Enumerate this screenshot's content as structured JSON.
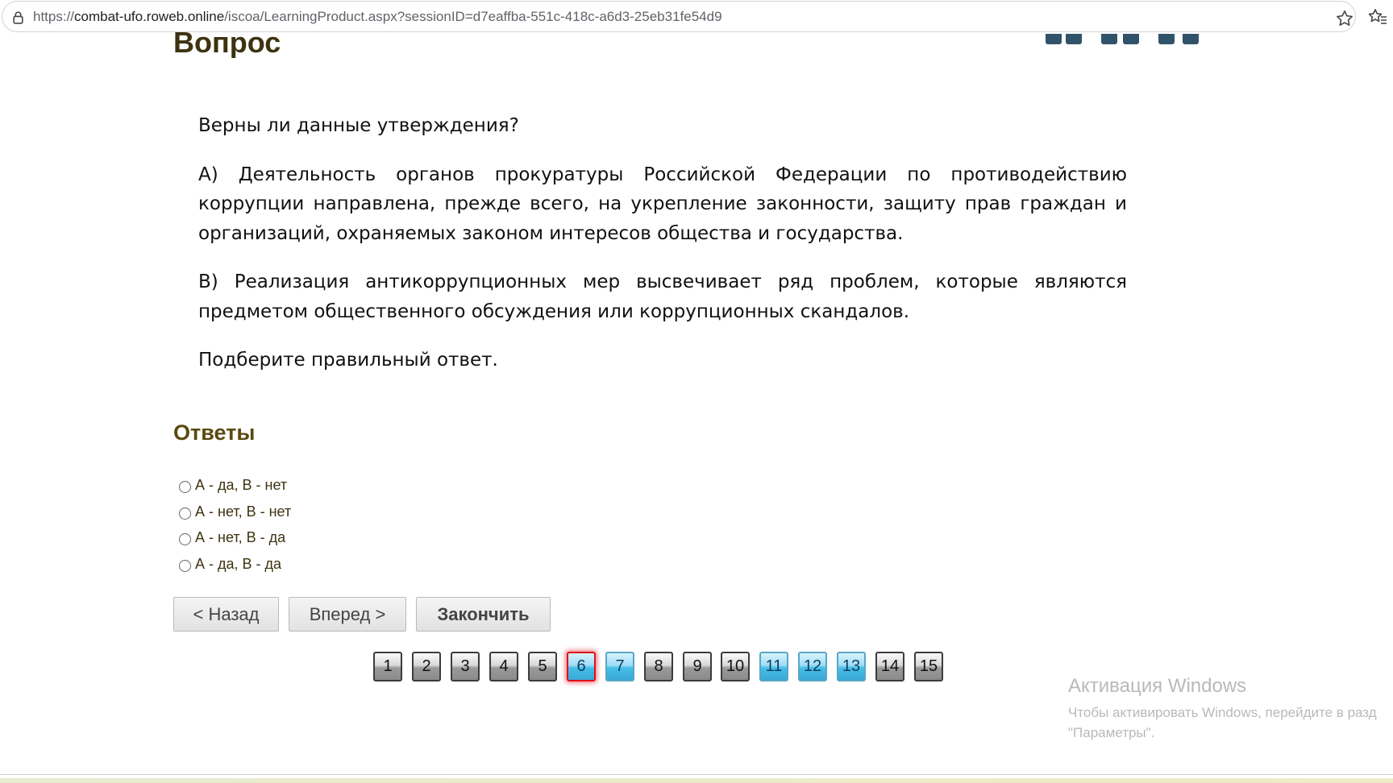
{
  "browser": {
    "url_prefix": "https://",
    "url_domain": "combat-ufo.roweb.online",
    "url_path": "/iscoa/LearningProduct.aspx?sessionID=d7eaffba-551c-418c-a6d3-25eb31fe54d9",
    "icons": [
      "lock-icon",
      "star-icon",
      "favorites-icon"
    ]
  },
  "page": {
    "question_heading": "Вопрос",
    "question": {
      "intro": "Верны ли данные утверждения?",
      "statement_a": "А) Деятельность органов прокуратуры Российской Федерации по противодействию коррупции направлена, прежде всего, на укрепление законности, защиту прав граждан и организаций, охраняемых законом интересов общества и государства.",
      "statement_b": "В) Реализация антикоррупционных мер высвечивает ряд проблем, которые являются предметом общественного обсуждения или коррупционных скандалов.",
      "prompt": "Подберите правильный ответ."
    },
    "answers_heading": "Ответы",
    "answers": [
      {
        "label": "А - да, В - нет",
        "selected": false
      },
      {
        "label": "А - нет, В - нет",
        "selected": false
      },
      {
        "label": "А - нет, В - да",
        "selected": false
      },
      {
        "label": "А - да, В - да",
        "selected": false
      }
    ],
    "buttons": {
      "back": "< Назад",
      "forward": "Вперед >",
      "finish": "Закончить"
    },
    "pager": {
      "current": "6",
      "pages": [
        {
          "label": "1",
          "state": "gray"
        },
        {
          "label": "2",
          "state": "gray"
        },
        {
          "label": "3",
          "state": "gray"
        },
        {
          "label": "4",
          "state": "gray"
        },
        {
          "label": "5",
          "state": "gray"
        },
        {
          "label": "6",
          "state": "current"
        },
        {
          "label": "7",
          "state": "blue"
        },
        {
          "label": "8",
          "state": "gray"
        },
        {
          "label": "9",
          "state": "gray"
        },
        {
          "label": "10",
          "state": "gray"
        },
        {
          "label": "11",
          "state": "blue"
        },
        {
          "label": "12",
          "state": "blue"
        },
        {
          "label": "13",
          "state": "blue"
        },
        {
          "label": "14",
          "state": "gray"
        },
        {
          "label": "15",
          "state": "gray"
        }
      ]
    }
  },
  "watermark": {
    "title": "Активация Windows",
    "line1": "Чтобы активировать Windows, перейдите в разд",
    "line2": "\"Параметры\"."
  },
  "colors": {
    "heading": "#3d3310",
    "answers_heading": "#5a4a10",
    "pager_blue": "#45bfe8",
    "pager_current_border": "#e0101a",
    "header_widget": "#31536a"
  }
}
